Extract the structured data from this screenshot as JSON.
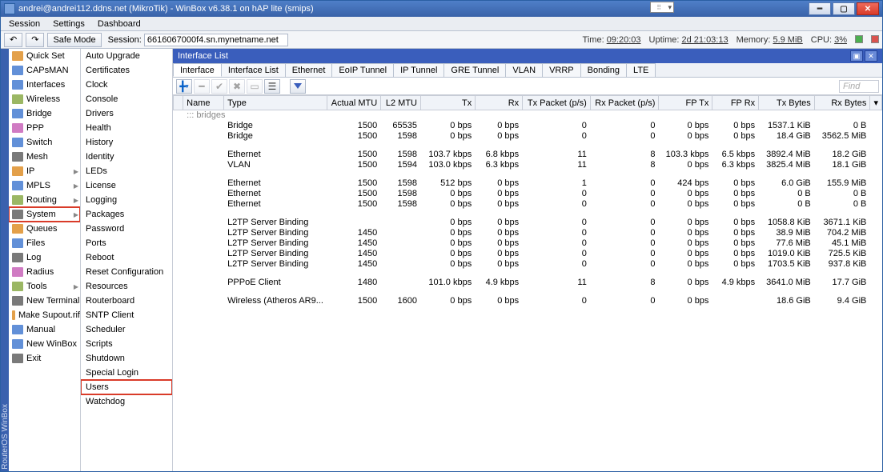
{
  "window": {
    "title": "andrei@andrei112.ddns.net (MikroTik) - WinBox v6.38.1 on hAP lite (smips)"
  },
  "menu": {
    "items": [
      "Session",
      "Settings",
      "Dashboard"
    ]
  },
  "toolbar": {
    "back": "↶",
    "fwd": "↷",
    "safe_mode": "Safe Mode",
    "session_label": "Session:",
    "session_value": "6616067000f4.sn.mynetname.net"
  },
  "status": {
    "time_label": "Time:",
    "time": "09:20:03",
    "uptime_label": "Uptime:",
    "uptime": "2d 21:03:13",
    "memory_label": "Memory:",
    "memory": "5.9 MiB",
    "cpu_label": "CPU:",
    "cpu": "3%"
  },
  "side_brand": "RouterOS  WinBox",
  "sidebar": [
    {
      "label": "Quick Set",
      "ic": "c1"
    },
    {
      "label": "CAPsMAN",
      "ic": "c2"
    },
    {
      "label": "Interfaces",
      "ic": "c2"
    },
    {
      "label": "Wireless",
      "ic": "c3"
    },
    {
      "label": "Bridge",
      "ic": "c2"
    },
    {
      "label": "PPP",
      "ic": "c4"
    },
    {
      "label": "Switch",
      "ic": "c2"
    },
    {
      "label": "Mesh",
      "ic": "c5"
    },
    {
      "label": "IP",
      "ic": "c1",
      "caret": true
    },
    {
      "label": "MPLS",
      "ic": "c2",
      "caret": true
    },
    {
      "label": "Routing",
      "ic": "c3",
      "caret": true
    },
    {
      "label": "System",
      "ic": "c5",
      "caret": true,
      "hl": true
    },
    {
      "label": "Queues",
      "ic": "c1"
    },
    {
      "label": "Files",
      "ic": "c2"
    },
    {
      "label": "Log",
      "ic": "c5"
    },
    {
      "label": "Radius",
      "ic": "c4"
    },
    {
      "label": "Tools",
      "ic": "c3",
      "caret": true
    },
    {
      "label": "New Terminal",
      "ic": "c5"
    },
    {
      "label": "Make Supout.rif",
      "ic": "c1"
    },
    {
      "label": "Manual",
      "ic": "c2"
    },
    {
      "label": "New WinBox",
      "ic": "c2"
    },
    {
      "label": "Exit",
      "ic": "c5"
    }
  ],
  "submenu": [
    "Auto Upgrade",
    "Certificates",
    "Clock",
    "Console",
    "Drivers",
    "Health",
    "History",
    "Identity",
    "LEDs",
    "License",
    "Logging",
    "Packages",
    "Password",
    "Ports",
    "Reboot",
    "Reset Configuration",
    "Resources",
    "Routerboard",
    "SNTP Client",
    "Scheduler",
    "Scripts",
    "Shutdown",
    "Special Login",
    "Users",
    "Watchdog"
  ],
  "submenu_section_label": "::: bridges",
  "panel": {
    "title": "Interface List",
    "tabs": [
      "Interface",
      "Interface List",
      "Ethernet",
      "EoIP Tunnel",
      "IP Tunnel",
      "GRE Tunnel",
      "VLAN",
      "VRRP",
      "Bonding",
      "LTE"
    ],
    "find_placeholder": "Find"
  },
  "columns": [
    "",
    "Name",
    "Type",
    "Actual MTU",
    "L2 MTU",
    "Tx",
    "Rx",
    "Tx Packet (p/s)",
    "Rx Packet (p/s)",
    "FP Tx",
    "FP Rx",
    "Tx Bytes",
    "Rx Bytes"
  ],
  "rows": [
    {
      "f": "",
      "n": "",
      "t": "Bridge",
      "mtu": "1500",
      "l2": "65535",
      "tx": "0 bps",
      "rx": "0 bps",
      "tp": "0",
      "rp": "0",
      "ftx": "0 bps",
      "frx": "0 bps",
      "txb": "1537.1 KiB",
      "rxb": "0 B"
    },
    {
      "f": "",
      "n": "",
      "t": "Bridge",
      "mtu": "1500",
      "l2": "1598",
      "tx": "0 bps",
      "rx": "0 bps",
      "tp": "0",
      "rp": "0",
      "ftx": "0 bps",
      "frx": "0 bps",
      "txb": "18.4 GiB",
      "rxb": "3562.5 MiB"
    },
    {
      "gap": true
    },
    {
      "f": "",
      "n": "",
      "t": "Ethernet",
      "mtu": "1500",
      "l2": "1598",
      "tx": "103.7 kbps",
      "rx": "6.8 kbps",
      "tp": "11",
      "rp": "8",
      "ftx": "103.3 kbps",
      "frx": "6.5 kbps",
      "txb": "3892.4 MiB",
      "rxb": "18.2 GiB"
    },
    {
      "f": "",
      "n": "",
      "t": "VLAN",
      "mtu": "1500",
      "l2": "1594",
      "tx": "103.0 kbps",
      "rx": "6.3 kbps",
      "tp": "11",
      "rp": "8",
      "ftx": "0 bps",
      "frx": "6.3 kbps",
      "txb": "3825.4 MiB",
      "rxb": "18.1 GiB"
    },
    {
      "gap": true
    },
    {
      "f": "",
      "n": "",
      "t": "Ethernet",
      "mtu": "1500",
      "l2": "1598",
      "tx": "512 bps",
      "rx": "0 bps",
      "tp": "1",
      "rp": "0",
      "ftx": "424 bps",
      "frx": "0 bps",
      "txb": "6.0 GiB",
      "rxb": "155.9 MiB"
    },
    {
      "f": "",
      "n": "",
      "t": "Ethernet",
      "mtu": "1500",
      "l2": "1598",
      "tx": "0 bps",
      "rx": "0 bps",
      "tp": "0",
      "rp": "0",
      "ftx": "0 bps",
      "frx": "0 bps",
      "txb": "0 B",
      "rxb": "0 B"
    },
    {
      "f": "",
      "n": "",
      "t": "Ethernet",
      "mtu": "1500",
      "l2": "1598",
      "tx": "0 bps",
      "rx": "0 bps",
      "tp": "0",
      "rp": "0",
      "ftx": "0 bps",
      "frx": "0 bps",
      "txb": "0 B",
      "rxb": "0 B"
    },
    {
      "gap": true
    },
    {
      "f": "",
      "n": "",
      "t": "L2TP Server Binding",
      "mtu": "",
      "l2": "",
      "tx": "0 bps",
      "rx": "0 bps",
      "tp": "0",
      "rp": "0",
      "ftx": "0 bps",
      "frx": "0 bps",
      "txb": "1058.8 KiB",
      "rxb": "3671.1 KiB"
    },
    {
      "f": "",
      "n": "",
      "t": "L2TP Server Binding",
      "mtu": "1450",
      "l2": "",
      "tx": "0 bps",
      "rx": "0 bps",
      "tp": "0",
      "rp": "0",
      "ftx": "0 bps",
      "frx": "0 bps",
      "txb": "38.9 MiB",
      "rxb": "704.2 MiB"
    },
    {
      "f": "",
      "n": "",
      "t": "L2TP Server Binding",
      "mtu": "1450",
      "l2": "",
      "tx": "0 bps",
      "rx": "0 bps",
      "tp": "0",
      "rp": "0",
      "ftx": "0 bps",
      "frx": "0 bps",
      "txb": "77.6 MiB",
      "rxb": "45.1 MiB"
    },
    {
      "f": "",
      "n": "",
      "t": "L2TP Server Binding",
      "mtu": "1450",
      "l2": "",
      "tx": "0 bps",
      "rx": "0 bps",
      "tp": "0",
      "rp": "0",
      "ftx": "0 bps",
      "frx": "0 bps",
      "txb": "1019.0 KiB",
      "rxb": "725.5 KiB"
    },
    {
      "f": "",
      "n": "",
      "t": "L2TP Server Binding",
      "mtu": "1450",
      "l2": "",
      "tx": "0 bps",
      "rx": "0 bps",
      "tp": "0",
      "rp": "0",
      "ftx": "0 bps",
      "frx": "0 bps",
      "txb": "1703.5 KiB",
      "rxb": "937.8 KiB"
    },
    {
      "gap": true
    },
    {
      "f": "",
      "n": "",
      "t": "PPPoE Client",
      "mtu": "1480",
      "l2": "",
      "tx": "101.0 kbps",
      "rx": "4.9 kbps",
      "tp": "11",
      "rp": "8",
      "ftx": "0 bps",
      "frx": "4.9 kbps",
      "txb": "3641.0 MiB",
      "rxb": "17.7 GiB"
    },
    {
      "gap": true
    },
    {
      "f": "",
      "n": "",
      "t": "Wireless (Atheros AR9...",
      "mtu": "1500",
      "l2": "1600",
      "tx": "0 bps",
      "rx": "0 bps",
      "tp": "0",
      "rp": "0",
      "ftx": "0 bps",
      "frx": "",
      "txb": "18.6 GiB",
      "rxb": "9.4 GiB"
    }
  ]
}
